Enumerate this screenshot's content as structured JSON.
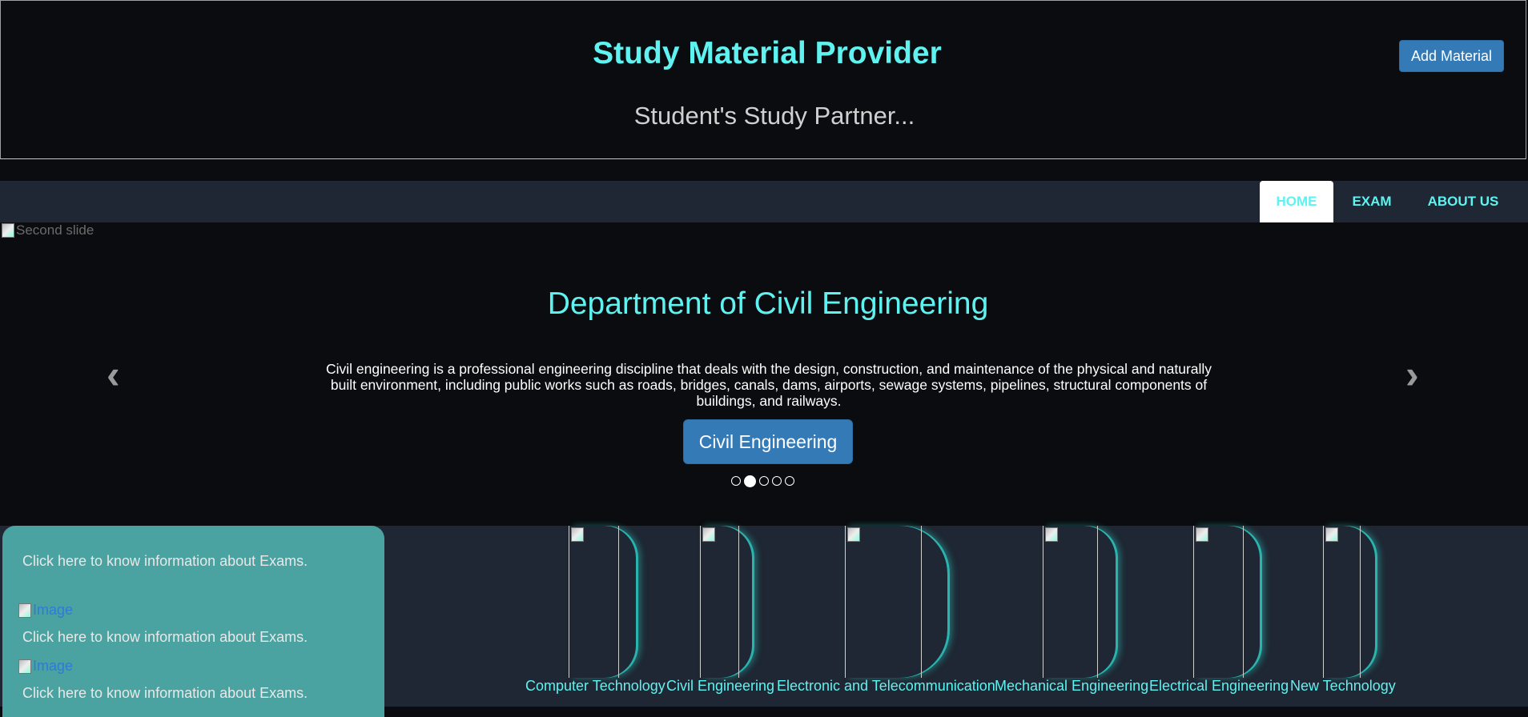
{
  "header": {
    "title": "Study Material Provider",
    "tagline": "Student's Study Partner...",
    "add_button": "Add Material"
  },
  "nav": {
    "items": [
      {
        "label": "HOME",
        "active": true
      },
      {
        "label": "EXAM",
        "active": false
      },
      {
        "label": "ABOUT US",
        "active": false
      }
    ]
  },
  "carousel": {
    "image_alt": "Second slide",
    "title": "Department of Civil Engineering",
    "description": "Civil engineering is a professional engineering discipline that deals with the design, construction, and maintenance of the physical and naturally built environment, including public works such as roads, bridges, canals, dams, airports, sewage systems, pipelines, structural components of buildings, and railways.",
    "button": "Civil Engineering",
    "prev_icon": "chevron-left-icon",
    "next_icon": "chevron-right-icon",
    "slides": 5,
    "active_slide": 2
  },
  "exam_panel": {
    "links": [
      "Click here to know information about Exams.",
      "Click here to know information about Exams.",
      "Click here to know information about Exams."
    ],
    "image_alt": "Image"
  },
  "departments": [
    "Computer Technology",
    "Civil Engineering",
    "Electronic and Telecommunication",
    "Mechanical Engineering",
    "Electrical Engineering",
    "New Technology"
  ],
  "colors": {
    "accent": "#5ef3f1",
    "button": "#337ab7",
    "panel": "#4aa3a0",
    "nav_bg": "#1e2733",
    "page_bg": "#0a0c0f"
  }
}
